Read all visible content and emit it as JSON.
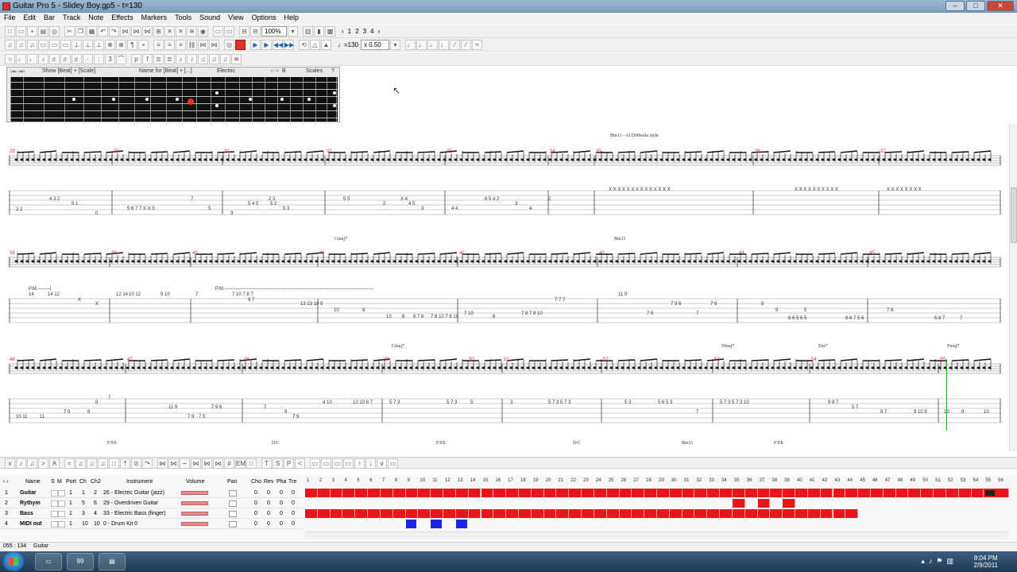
{
  "window": {
    "title": "Guitar Pro 5 - Slidey Boy.gp5 - t=130",
    "min": "–",
    "max": "□",
    "close": "✕"
  },
  "menu": [
    "File",
    "Edit",
    "Bar",
    "Track",
    "Note",
    "Effects",
    "Markers",
    "Tools",
    "Sound",
    "View",
    "Options",
    "Help"
  ],
  "toolbar": {
    "zoom": "100%",
    "pages": [
      "1",
      "2",
      "3",
      "4"
    ],
    "tempo": "♩=130",
    "speed": "x 0.50"
  },
  "fretpanel": {
    "labels": [
      "Show [Beat] + [Scale]",
      "Name for [Beat] + [...]",
      "Electric",
      "B",
      "Scales"
    ]
  },
  "score": {
    "annotation": "Bm11 - Al DiMeola style",
    "chords_row2": [
      "Cmaj7",
      "Bm11"
    ],
    "chords_row3": [
      "Cmaj7",
      "Dmaj7",
      "Em7",
      "Fmaj7"
    ],
    "bottom_labels": [
      "F/Eb",
      "D/C",
      "F/Eb",
      "D/C",
      "Bm11",
      "F/Eb"
    ],
    "bar_numbers_row1": [
      "29",
      "30",
      "31",
      "32",
      "33",
      "34",
      "35",
      "36",
      "37"
    ],
    "bar_numbers_row2": [
      "38",
      "39",
      "40",
      "41",
      "42",
      "43",
      "44",
      "45"
    ],
    "bar_numbers_row3": [
      "46",
      "47",
      "48",
      "49",
      "50",
      "51",
      "52",
      "53",
      "54",
      "55"
    ],
    "palm_mute_1": "P.M.-------┤",
    "palm_mute_2": "P.M.----------------------------------------------------------------------------------------------",
    "tab_row1": [
      "2    2",
      "4 3 2",
      "5 1",
      "0",
      "5 6 7 7 X X 5",
      "7",
      "5",
      "3",
      "5 4 5",
      "2 3",
      "5 2",
      "5 3",
      "5 5",
      "2",
      "X 4",
      "4 5",
      "3",
      "4    4",
      "6 5 4 2",
      "3",
      "4",
      "2",
      "X X X   X X X   X   X X X X   X X X",
      "X X X   X   X X X X X   X",
      "X X X   X X X X   X"
    ],
    "tab_row2": [
      "14",
      "14  12",
      "X",
      "X",
      "12  14",
      "10 12",
      "9 10",
      "7",
      "7 10 7 8 7",
      "9 7",
      "13  13 10 9",
      "10",
      "8",
      "10",
      "8",
      "8 7 8",
      "7 8 10 7 8 10",
      "7 10",
      "8",
      "7 8 7 8 10",
      "7 7 7",
      "11 9",
      "7 9 6",
      "7 9",
      "7 5",
      "7",
      "8",
      "9",
      "8 6 5 6 5",
      "5",
      "8 6 7 5 6",
      "7 8",
      "5 8 7",
      "7"
    ],
    "tab_row3": [
      "10 11",
      "11",
      "7 9",
      "9",
      "7",
      "8",
      "11 9",
      "7 9",
      "7 5",
      "7 9 6",
      "7",
      "9",
      "7 9",
      "4 10",
      "10 10 8 7",
      "5 7 3",
      "5 7 3",
      "5",
      "3",
      "5 7 3  5 7 3",
      "5 3",
      "5 6 5 3",
      "7",
      "5 7 3   5 7 3 10",
      "9 8 7",
      "5 7",
      "9 7",
      "9 10 9",
      "10",
      "9",
      "10"
    ]
  },
  "tracks": {
    "headers": [
      "Name",
      "S",
      "M",
      "Port",
      "Ch",
      "Ch2",
      "Instrument",
      "Volume",
      "Pan",
      "Cho",
      "Rev",
      "Pha",
      "Tre"
    ],
    "rows": [
      {
        "num": "1",
        "name": "Guitar",
        "port": "1",
        "ch": "1",
        "ch2": "2",
        "instrument": "26 - Electric Guitar (jazz)",
        "cho": "0",
        "rev": "0",
        "pha": "0",
        "tre": "0"
      },
      {
        "num": "2",
        "name": "Rythym",
        "port": "1",
        "ch": "5",
        "ch2": "6",
        "instrument": "29 - Overdriven Guitar",
        "cho": "0",
        "rev": "0",
        "pha": "0",
        "tre": "0"
      },
      {
        "num": "3",
        "name": "Bass",
        "port": "1",
        "ch": "3",
        "ch2": "4",
        "instrument": "33 - Electric Bass (finger)",
        "cho": "0",
        "rev": "0",
        "pha": "0",
        "tre": "0"
      },
      {
        "num": "4",
        "name": "MIDI out",
        "port": "1",
        "ch": "10",
        "ch2": "10",
        "instrument": "0 - Drum Kit 0",
        "cho": "0",
        "rev": "0",
        "pha": "0",
        "tre": "0"
      }
    ],
    "bar_count_visible": 56
  },
  "status": {
    "position": "055 : 134",
    "track": "Guitar"
  },
  "taskbar": {
    "time": "8:04 PM",
    "date": "2/9/2011",
    "app_badge": "99"
  },
  "colors": {
    "track_bar": "#e8161b",
    "drum_bar": "#1a25e6",
    "cursor": "#22aa22"
  }
}
